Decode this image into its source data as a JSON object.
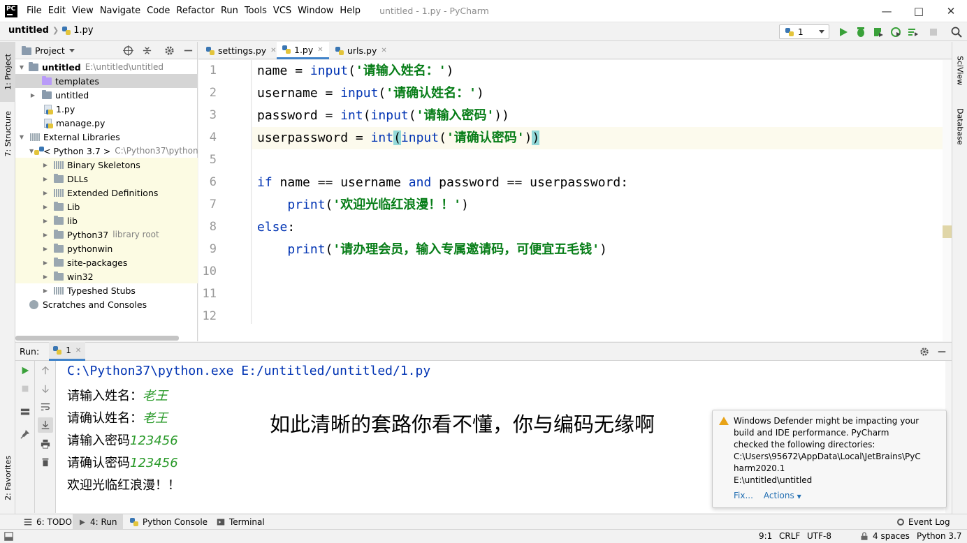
{
  "app": {
    "logo": "PC",
    "window_title": "untitled - 1.py - PyCharm",
    "menu": [
      "File",
      "Edit",
      "View",
      "Navigate",
      "Code",
      "Refactor",
      "Run",
      "Tools",
      "VCS",
      "Window",
      "Help"
    ]
  },
  "navbar": {
    "project": "untitled",
    "file": "1.py",
    "run_config": "1"
  },
  "left_strip": {
    "project_tab": "1: Project",
    "structure_tab": "7: Structure",
    "favorites_tab": "2: Favorites"
  },
  "right_strip": {
    "sciview_tab": "SciView",
    "database_tab": "Database"
  },
  "project_panel": {
    "title": "Project",
    "tree": [
      {
        "label": "untitled",
        "extra": "E:\\untitled\\untitled"
      },
      {
        "label": "templates"
      },
      {
        "label": "untitled"
      },
      {
        "label": "1.py"
      },
      {
        "label": "manage.py"
      },
      {
        "label": "External Libraries"
      },
      {
        "label": "< Python 3.7 >",
        "extra": "C:\\Python37\\python"
      },
      {
        "label": "Binary Skeletons"
      },
      {
        "label": "DLLs"
      },
      {
        "label": "Extended Definitions"
      },
      {
        "label": "Lib"
      },
      {
        "label": "lib"
      },
      {
        "label": "Python37",
        "extra": "library root"
      },
      {
        "label": "pythonwin"
      },
      {
        "label": "site-packages"
      },
      {
        "label": "win32"
      },
      {
        "label": "Typeshed Stubs"
      },
      {
        "label": "Scratches and Consoles"
      }
    ]
  },
  "editor": {
    "tabs": [
      "settings.py",
      "1.py",
      "urls.py"
    ],
    "line_numbers": [
      "1",
      "2",
      "3",
      "4",
      "5",
      "6",
      "7",
      "8",
      "9",
      "10",
      "11",
      "12"
    ],
    "code": {
      "l1_var": "name",
      "l1_op": " = ",
      "l1_fn": "input",
      "l1_str": "'请输入姓名：'",
      "l2_var": "username",
      "l2_op": " = ",
      "l2_fn": "input",
      "l2_str": "'请确认姓名：'",
      "l3_var": "password",
      "l3_op": " = ",
      "l3_fn": "int",
      "l3_fn2": "input",
      "l3_str": "'请输入密码'",
      "l4_var": "userpassword",
      "l4_op": " = ",
      "l4_fn": "int",
      "l4_fn2": "input",
      "l4_str": "'请确认密码'",
      "l6_if": "if",
      "l6_a": " name == username ",
      "l6_and": "and",
      "l6_b": " password == userpassword:",
      "l7_fn": "print",
      "l7_str": "'欢迎光临红浪漫！！'",
      "l8_else": "else",
      "l9_fn": "print",
      "l9_str": "'请办理会员，输入专属邀请码，可便宜五毛钱'"
    }
  },
  "run_panel": {
    "label": "Run:",
    "tab": "1",
    "output": {
      "cmd": "C:\\Python37\\python.exe E:/untitled/untitled/1.py",
      "p1": "请输入姓名：",
      "v1": "老王",
      "p2": "请确认姓名：",
      "v2": "老王",
      "p3": "请输入密码",
      "v3": "123456",
      "p4": "请确认密码",
      "v4": "123456",
      "result": "欢迎光临红浪漫！！"
    },
    "caption": "如此清晰的套路你看不懂，你与编码无缘啊"
  },
  "notification": {
    "lines": [
      "Windows Defender might be impacting your",
      "build and IDE performance. PyCharm",
      "checked the following directories:",
      "C:\\Users\\95672\\AppData\\Local\\JetBrains\\PyC",
      "harm2020.1",
      "E:\\untitled\\untitled"
    ],
    "fix": "Fix...",
    "actions": "Actions"
  },
  "bottom_tabs": [
    "6: TODO",
    "4: Run",
    "Python Console",
    "Terminal"
  ],
  "event_log": "Event Log",
  "status": {
    "position": "9:1",
    "line_sep": "CRLF",
    "encoding": "UTF-8",
    "indent": "4 spaces",
    "interpreter": "Python 3.7"
  },
  "colors": {
    "keyword": "#0033b3",
    "string": "#067d17",
    "input_echo": "#2a9a2a",
    "link": "#2470b3",
    "run_green": "#3aa13a"
  }
}
